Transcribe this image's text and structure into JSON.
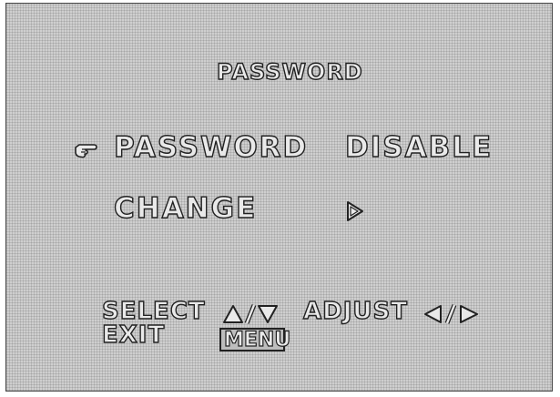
{
  "screen": {
    "title": "PASSWORD"
  },
  "menu": {
    "items": [
      {
        "label": "PASSWORD",
        "value": "DISABLE",
        "selected": true
      },
      {
        "label": "CHANGE",
        "value_icon": "right-triangle-outline-icon"
      }
    ],
    "cursor_icon": "pointing-hand-icon"
  },
  "footer": {
    "select_label": "SELECT",
    "select_keys_icon": "up-down-triangles-icon",
    "adjust_label": "ADJUST",
    "adjust_keys_icon": "left-right-triangles-icon",
    "exit_label": "EXIT",
    "exit_key": "MENU"
  },
  "colors": {
    "background": "#cfcfcf",
    "text_fill": "#e9e9e9",
    "text_outline": "#222222"
  }
}
